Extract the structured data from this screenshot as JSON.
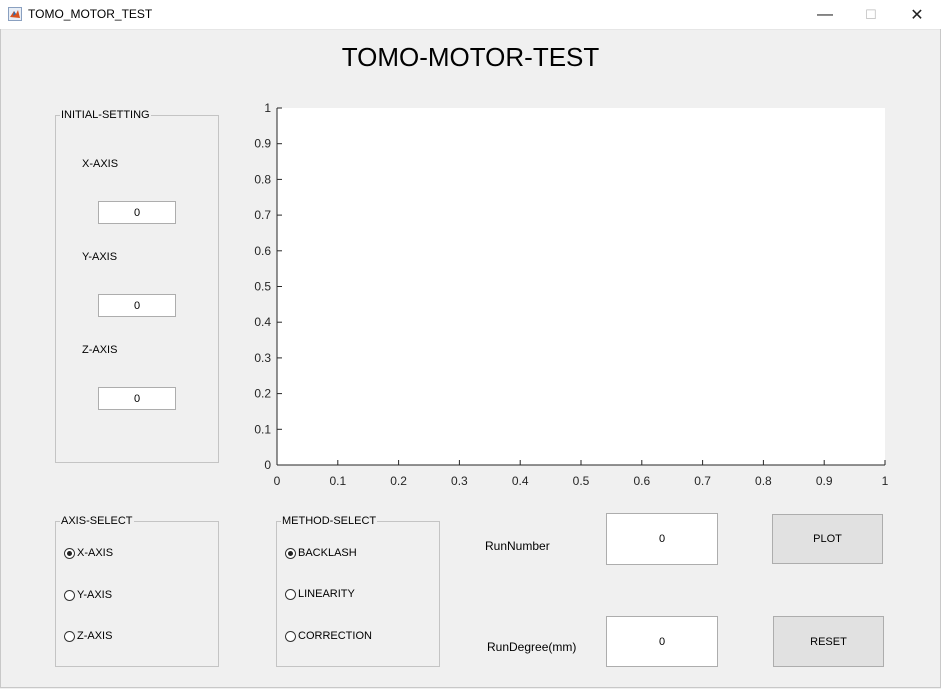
{
  "window": {
    "title": "TOMO_MOTOR_TEST",
    "app_icon": "matlab-icon",
    "controls": {
      "minimize": "—",
      "maximize": "☐",
      "close": "✕"
    }
  },
  "header": {
    "title": "TOMO-MOTOR-TEST"
  },
  "initial_setting": {
    "legend": "INITIAL-SETTING",
    "x_label": "X-AXIS",
    "x_value": "0",
    "y_label": "Y-AXIS",
    "y_value": "0",
    "z_label": "Z-AXIS",
    "z_value": "0"
  },
  "axis_select": {
    "legend": "AXIS-SELECT",
    "options": [
      {
        "label": "X-AXIS",
        "selected": true
      },
      {
        "label": "Y-AXIS",
        "selected": false
      },
      {
        "label": "Z-AXIS",
        "selected": false
      }
    ]
  },
  "method_select": {
    "legend": "METHOD-SELECT",
    "options": [
      {
        "label": "BACKLASH",
        "selected": true
      },
      {
        "label": "LINEARITY",
        "selected": false
      },
      {
        "label": "CORRECTION",
        "selected": false
      }
    ]
  },
  "run": {
    "number_label": "RunNumber",
    "number_value": "0",
    "degree_label": "RunDegree(mm)",
    "degree_value": "0"
  },
  "buttons": {
    "plot": "PLOT",
    "reset": "RESET"
  },
  "chart_data": {
    "type": "line",
    "title": "",
    "xlabel": "",
    "ylabel": "",
    "xlim": [
      0,
      1
    ],
    "ylim": [
      0,
      1
    ],
    "xticks": [
      "0",
      "0.1",
      "0.2",
      "0.3",
      "0.4",
      "0.5",
      "0.6",
      "0.7",
      "0.8",
      "0.9",
      "1"
    ],
    "yticks": [
      "0",
      "0.1",
      "0.2",
      "0.3",
      "0.4",
      "0.5",
      "0.6",
      "0.7",
      "0.8",
      "0.9",
      "1"
    ],
    "series": [],
    "grid": false
  }
}
